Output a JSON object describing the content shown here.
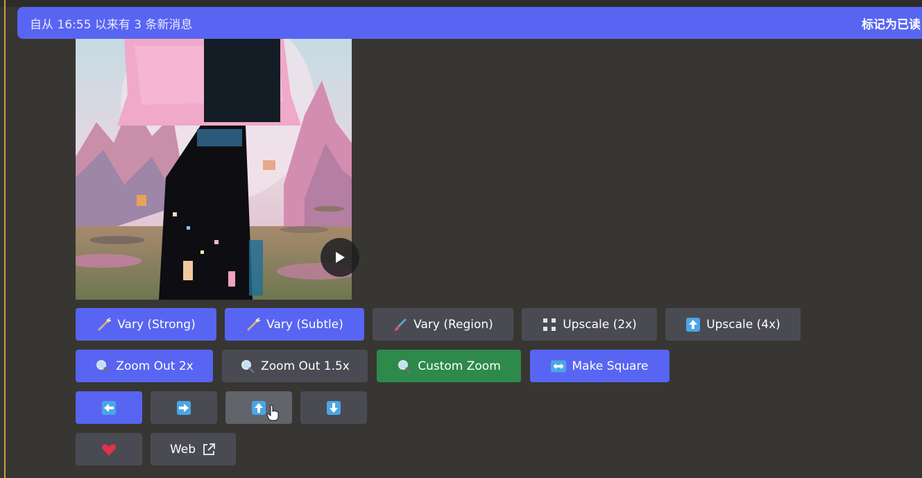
{
  "banner": {
    "text": "自从 16:55 以来有 3 条新消息",
    "action": "标记为已读"
  },
  "buttons_row1": [
    {
      "label": "Vary (Strong)",
      "icon": "magic-wand-icon",
      "style": "blue"
    },
    {
      "label": "Vary (Subtle)",
      "icon": "magic-wand-icon",
      "style": "blue"
    },
    {
      "label": "Vary (Region)",
      "icon": "paintbrush-icon",
      "style": "gray"
    },
    {
      "label": "Upscale (2x)",
      "icon": "expand-icon",
      "style": "gray"
    },
    {
      "label": "Upscale (4x)",
      "icon": "up-arrow-box-icon",
      "style": "gray"
    }
  ],
  "buttons_row2": [
    {
      "label": "Zoom Out 2x",
      "icon": "magnifier-icon",
      "style": "blue"
    },
    {
      "label": "Zoom Out 1.5x",
      "icon": "magnifier-icon",
      "style": "gray"
    },
    {
      "label": "Custom Zoom",
      "icon": "magnifier-icon",
      "style": "green"
    },
    {
      "label": "Make Square",
      "icon": "left-right-arrow-icon",
      "style": "blue"
    }
  ],
  "pan_buttons": [
    {
      "icon": "arrow-left-icon",
      "style": "blue"
    },
    {
      "icon": "arrow-right-icon",
      "style": "gray"
    },
    {
      "icon": "arrow-up-icon",
      "style": "lightgray"
    },
    {
      "icon": "arrow-down-icon",
      "style": "gray"
    }
  ],
  "extra_buttons": [
    {
      "icon": "heart-icon",
      "style": "gray"
    },
    {
      "label": "Web",
      "icon": "external-link-icon",
      "style": "gray"
    }
  ],
  "colors": {
    "background": "#373632",
    "banner": "#5865f2",
    "blue_button": "#5865f2",
    "gray_button": "#4a4b52",
    "green_button": "#2d8a4a",
    "heart": "#e5304b"
  }
}
